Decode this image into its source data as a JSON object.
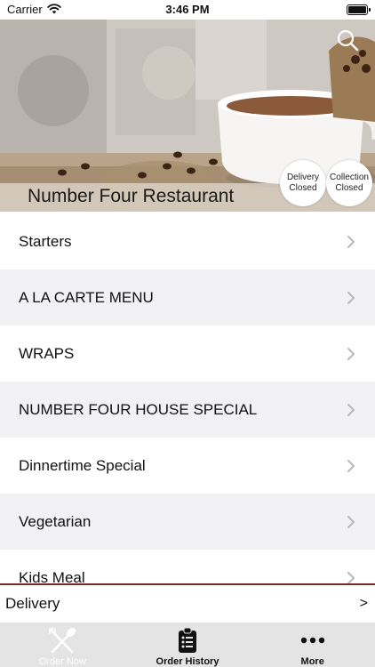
{
  "status_bar": {
    "carrier": "Carrier",
    "time": "3:46 PM",
    "icons": [
      "wifi-icon",
      "battery-icon"
    ]
  },
  "hero": {
    "restaurant_name": "Number Four Restaurant",
    "search_icon": "search-icon",
    "delivery_status": {
      "title": "Delivery",
      "state": "Closed"
    },
    "collection_status": {
      "title": "Collection",
      "state": "Closed"
    }
  },
  "menu": {
    "items": [
      {
        "label": "Starters"
      },
      {
        "label": "A LA CARTE MENU"
      },
      {
        "label": "WRAPS"
      },
      {
        "label": "NUMBER FOUR HOUSE SPECIAL"
      },
      {
        "label": "Dinnertime Special"
      },
      {
        "label": "Vegetarian"
      },
      {
        "label": "Kids Meal"
      }
    ],
    "chevron_icon": "chevron-right-icon"
  },
  "delivery_bar": {
    "label": "Delivery",
    "arrow": ">"
  },
  "tab_bar": {
    "tabs": [
      {
        "label": "Order Now",
        "icon": "fork-knife-icon"
      },
      {
        "label": "Order History",
        "icon": "clipboard-list-icon"
      },
      {
        "label": "More",
        "icon": "ellipsis-icon"
      }
    ]
  },
  "colors": {
    "accent_line": "#7b2a23",
    "tab_bar_bg": "#e4e4e4",
    "row_alt_bg": "#f2f2f4"
  }
}
